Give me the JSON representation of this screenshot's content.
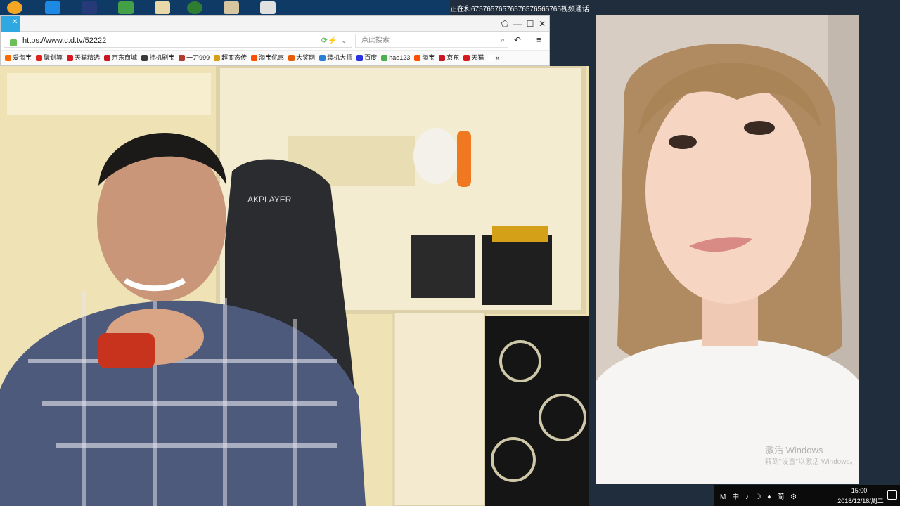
{
  "remote_window": {
    "title": "正在和67576576576576576565765视频通话"
  },
  "browser": {
    "url": "https://www.c.d.tv/52222",
    "search_placeholder": "点此搜索",
    "bookmarks": [
      {
        "label": "爱淘宝",
        "color": "#ff6a00"
      },
      {
        "label": "聚划算",
        "color": "#e0231d"
      },
      {
        "label": "天猫精选",
        "color": "#d71a20"
      },
      {
        "label": "京东商城",
        "color": "#c91623"
      },
      {
        "label": "挂机刷宝",
        "color": "#3a3a3a"
      },
      {
        "label": "一刀999",
        "color": "#b23a2b"
      },
      {
        "label": "超变态传",
        "color": "#d4a017"
      },
      {
        "label": "淘宝优惠",
        "color": "#ff5000"
      },
      {
        "label": "大奖网",
        "color": "#e85d04"
      },
      {
        "label": "装机大师",
        "color": "#2a7fd4"
      },
      {
        "label": "百度",
        "color": "#2932e1"
      },
      {
        "label": "hao123",
        "color": "#4caf50"
      },
      {
        "label": "淘宝",
        "color": "#ff5000"
      },
      {
        "label": "京东",
        "color": "#c91623"
      },
      {
        "label": "天猫",
        "color": "#d71a20"
      },
      {
        "label": "»",
        "color": "#ffffff"
      }
    ]
  },
  "desktop_icons": [
    "app-icon-1",
    "app-icon-2",
    "app-icon-3",
    "app-icon-4",
    "app-icon-5",
    "app-icon-6",
    "app-icon-7",
    "app-icon-8"
  ],
  "local_video": {
    "chair_text": "AKPLAYER"
  },
  "watermark": {
    "line1": "激活 Windows",
    "line2": "转到\"设置\"以激活 Windows。"
  },
  "taskbar": {
    "tray_text": "M 中 ♪ ☽ ♦ 简 ⚙",
    "time": "15:00",
    "date": "2018/12/18/周二"
  }
}
